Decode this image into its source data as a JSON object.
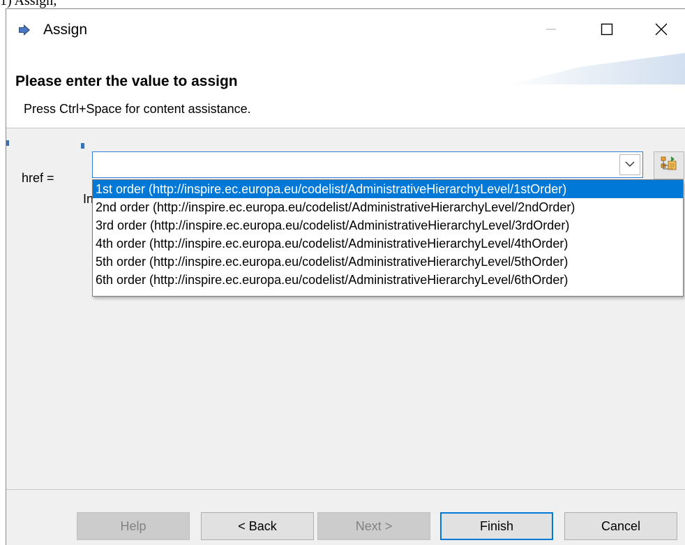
{
  "window": {
    "title": "Assign"
  },
  "banner": {
    "title": "Please enter the value to assign",
    "message": "Press Ctrl+Space for content assistance."
  },
  "form": {
    "href_label": "href  =",
    "hidden_label_fragment": "In",
    "combo_value": "",
    "options": [
      "1st order (http://inspire.ec.europa.eu/codelist/AdministrativeHierarchyLevel/1stOrder)",
      "2nd order (http://inspire.ec.europa.eu/codelist/AdministrativeHierarchyLevel/2ndOrder)",
      "3rd order (http://inspire.ec.europa.eu/codelist/AdministrativeHierarchyLevel/3rdOrder)",
      "4th order (http://inspire.ec.europa.eu/codelist/AdministrativeHierarchyLevel/4thOrder)",
      "5th order (http://inspire.ec.europa.eu/codelist/AdministrativeHierarchyLevel/5thOrder)",
      "6th order (http://inspire.ec.europa.eu/codelist/AdministrativeHierarchyLevel/6thOrder)"
    ],
    "selected_index": 0
  },
  "footer": {
    "help_label": "Help",
    "back_label": "< Back",
    "next_label": "Next >",
    "finish_label": "Finish",
    "cancel_label": "Cancel"
  },
  "icons": {
    "title": "arrow-right-icon",
    "minimize": "minimize-icon",
    "maximize": "maximize-icon",
    "close": "close-icon",
    "dropdown": "chevron-down-icon",
    "assist": "content-assist-icon"
  },
  "colors": {
    "accent": "#0078d7",
    "focus_border": "#2f7fd6",
    "disabled_text": "#838383"
  }
}
